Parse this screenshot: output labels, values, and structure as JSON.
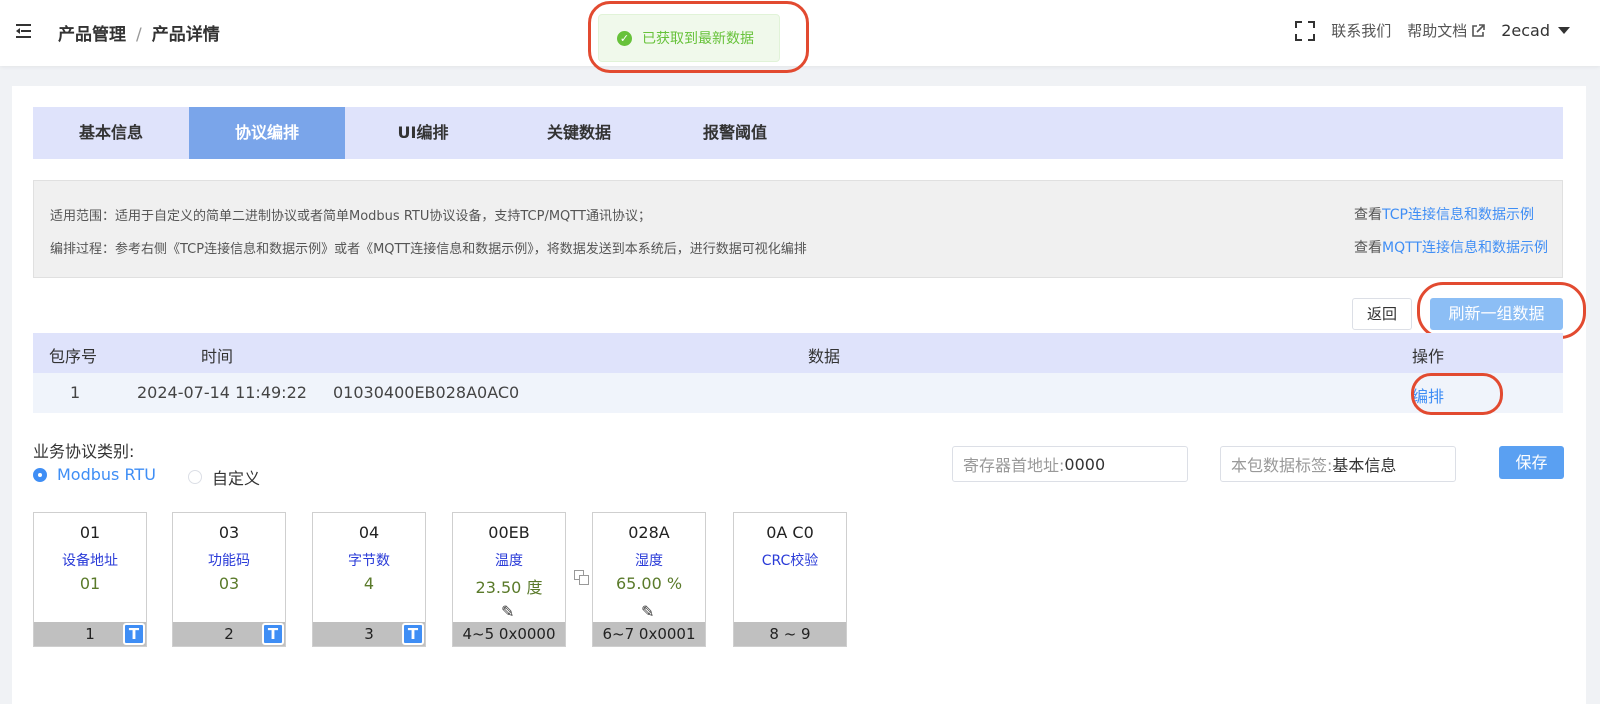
{
  "header": {
    "breadcrumb": [
      "产品管理",
      "产品详情"
    ],
    "breadcrumb_sep": "/",
    "contact_label": "联系我们",
    "help_label": "帮助文档",
    "user": "2ecad"
  },
  "toast": {
    "message": "已获取到最新数据",
    "color": "#67c23a"
  },
  "tabs": [
    {
      "label": "基本信息",
      "active": false
    },
    {
      "label": "协议编排",
      "active": true
    },
    {
      "label": "UI编排",
      "active": false
    },
    {
      "label": "关键数据",
      "active": false
    },
    {
      "label": "报警阈值",
      "active": false
    }
  ],
  "info": {
    "scope": "适用范围：适用于自定义的简单二进制协议或者简单Modbus RTU协议设备，支持TCP/MQTT通讯协议；",
    "process": "编排过程：参考右侧《TCP连接信息和数据示例》或者《MQTT连接信息和数据示例》，将数据发送到本系统后，进行数据可视化编排",
    "view_prefix": "查看",
    "tcp_link": "TCP连接信息和数据示例",
    "mqtt_link": "MQTT连接信息和数据示例"
  },
  "actions": {
    "back_label": "返回",
    "refresh_label": "刷新一组数据"
  },
  "table": {
    "headers": [
      "包序号",
      "时间",
      "数据",
      "操作"
    ],
    "rows": [
      {
        "seq": "1",
        "time": "2024-07-14 11:49:22",
        "data": "01030400EB028A0AC0",
        "action": "编排"
      }
    ]
  },
  "protocol": {
    "label": "业务协议类别:",
    "options": [
      "Modbus RTU",
      "自定义"
    ],
    "selected": "Modbus RTU"
  },
  "register": {
    "prefix": "寄存器首地址:",
    "value": "0000"
  },
  "tag": {
    "prefix": "本包数据标签:",
    "value": "基本信息"
  },
  "save_label": "保存",
  "blocks": [
    {
      "hex": "01",
      "name": "设备地址",
      "value": "01",
      "footer": "1",
      "badge": "T"
    },
    {
      "hex": "03",
      "name": "功能码",
      "value": "03",
      "footer": "2",
      "badge": "T"
    },
    {
      "hex": "04",
      "name": "字节数",
      "value": "4",
      "footer": "3",
      "badge": "T"
    },
    {
      "hex": "00EB",
      "name": "温度",
      "value": "23.50 度",
      "footer": "4~5 0x0000",
      "badge": ""
    },
    {
      "hex": "028A",
      "name": "湿度",
      "value": "65.00 %",
      "footer": "6~7 0x0001",
      "badge": ""
    },
    {
      "hex": "0A C0",
      "name": "CRC校验",
      "value": "",
      "footer": "8 ~ 9",
      "badge": ""
    }
  ]
}
